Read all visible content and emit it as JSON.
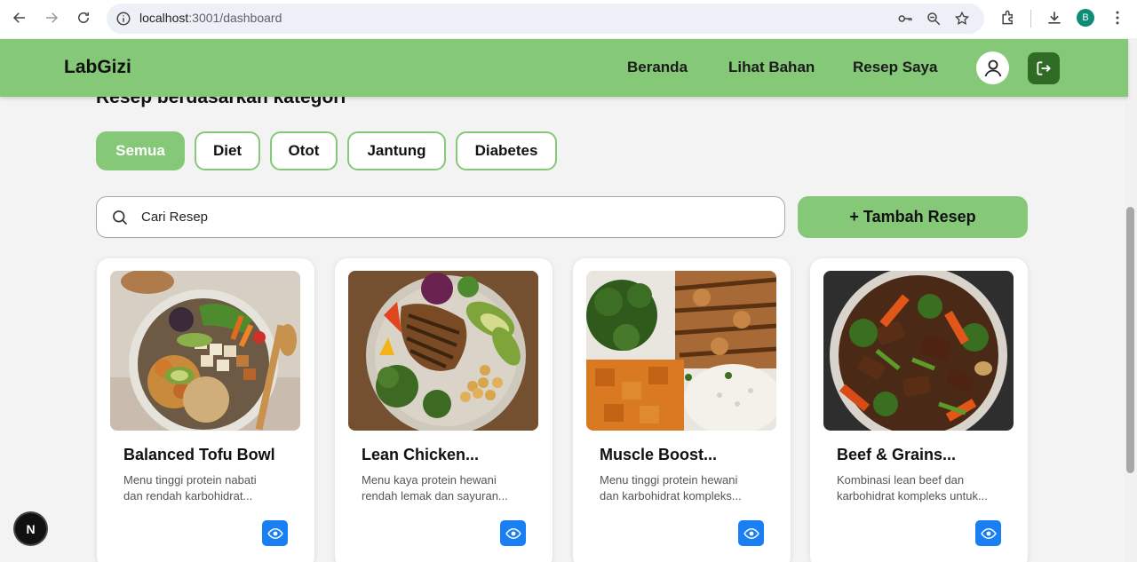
{
  "browser": {
    "url_host": "localhost",
    "url_path": ":3001/dashboard",
    "profile_initial": "B"
  },
  "header": {
    "brand": "LabGizi",
    "nav": [
      "Beranda",
      "Lihat Bahan",
      "Resep Saya"
    ]
  },
  "main": {
    "section_title": "Resep berdasarkan kategori",
    "categories": [
      "Semua",
      "Diet",
      "Otot",
      "Jantung",
      "Diabetes"
    ],
    "active_category": "Semua",
    "search_placeholder": "Cari Resep",
    "add_button": "+ Tambah Resep",
    "recipes": [
      {
        "title": "Balanced Tofu Bowl",
        "desc_line1": "Menu tinggi protein nabati",
        "desc_line2": "dan rendah karbohidrat..."
      },
      {
        "title": "Lean Chicken...",
        "desc_line1": "Menu kaya protein hewani",
        "desc_line2": "rendah lemak dan sayuran..."
      },
      {
        "title": "Muscle Boost...",
        "desc_line1": "Menu tinggi protein hewani",
        "desc_line2": "dan karbohidrat kompleks..."
      },
      {
        "title": "Beef & Grains...",
        "desc_line1": "Kombinasi lean beef dan",
        "desc_line2": "karbohidrat kompleks untuk..."
      }
    ]
  },
  "badge": {
    "label": "N"
  },
  "colors": {
    "primary_green": "#84c878",
    "dark_green": "#2f6b24",
    "view_blue": "#1a7ff2"
  }
}
